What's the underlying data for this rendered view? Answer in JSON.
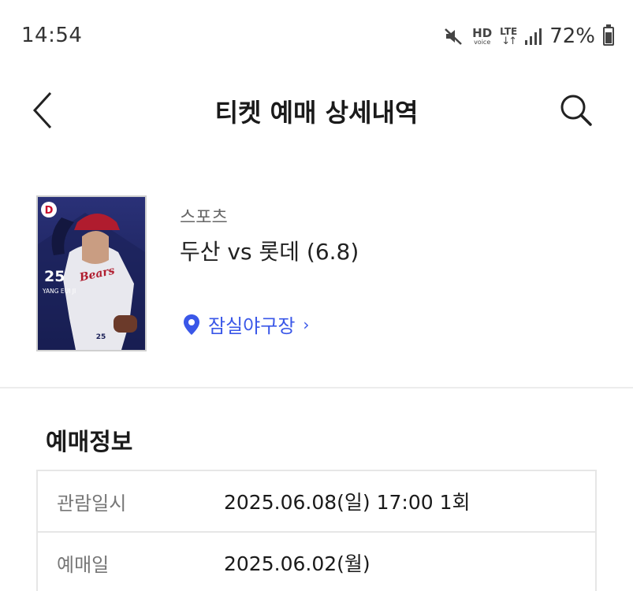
{
  "status_bar": {
    "time": "14:54",
    "hd_label": "HD",
    "voice_label": "voice",
    "lte_label": "LTE",
    "lte_arrows": "↓↑",
    "battery_percent": "72%",
    "battery_level": 0.72,
    "icons": [
      "mute-icon",
      "hd-voice-icon",
      "lte-icon",
      "signal-icon",
      "battery-icon"
    ]
  },
  "header": {
    "title": "티켓 예매 상세내역",
    "back_icon": "chevron-left-icon",
    "search_icon": "search-icon"
  },
  "event": {
    "category": "스포츠",
    "title": "두산 vs 롯데 (6.8)",
    "venue": "잠실야구장",
    "venue_chevron": "›",
    "poster": {
      "logo_letter": "D",
      "player_number": "25",
      "player_name": "YANG EUI JI",
      "jersey_text": "Bears",
      "jersey_number": "25"
    }
  },
  "section": {
    "title": "예매정보"
  },
  "info_rows": [
    {
      "label": "관람일시",
      "value": "2025.06.08(일) 17:00 1회"
    },
    {
      "label": "예매일",
      "value": "2025.06.02(월)"
    }
  ]
}
